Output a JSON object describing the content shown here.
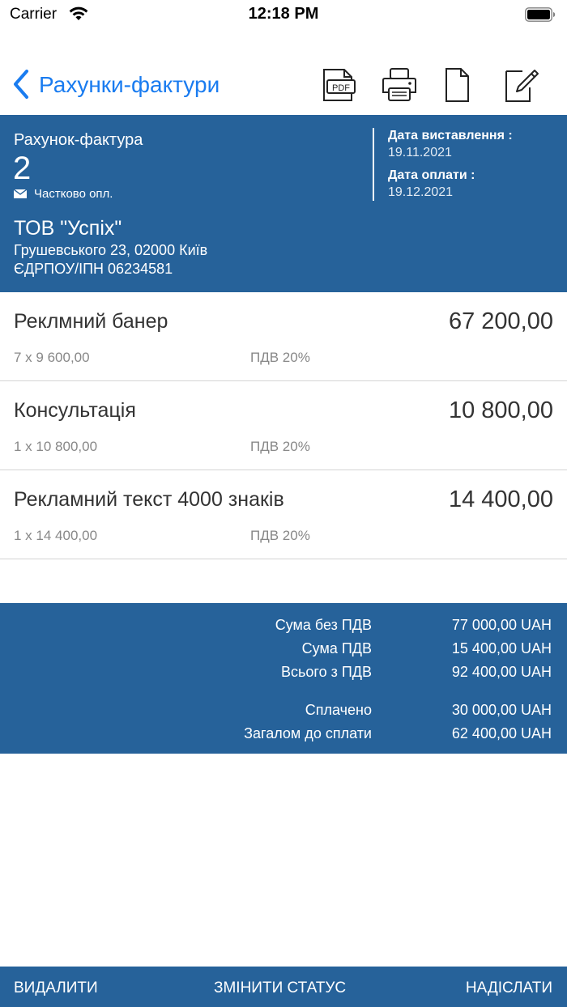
{
  "status_bar": {
    "carrier": "Carrier",
    "time": "12:18 PM"
  },
  "nav": {
    "back_label": "Рахунки-фактури",
    "accent_color": "#1a7cf0",
    "tools": [
      "pdf-icon",
      "printer-icon",
      "document-icon",
      "edit-icon"
    ],
    "pdf_icon_text": "PDF"
  },
  "invoice": {
    "kind": "Рахунок-фактура",
    "number": "2",
    "status": "Частково опл.",
    "issue_date_label": "Дата виставлення :",
    "issue_date": "19.11.2021",
    "due_date_label": "Дата оплати :",
    "due_date": "19.12.2021",
    "client_name": "ТОВ \"Успіх\"",
    "client_address": "Грушевського 23, 02000 Київ",
    "client_taxid": "ЄДРПОУ/ІПН 06234581",
    "panel_color": "#26629a"
  },
  "items": [
    {
      "name": "Реклмний банер",
      "total": "67 200,00",
      "qty_price": "7 x 9 600,00",
      "vat": "ПДВ 20%"
    },
    {
      "name": "Консультація",
      "total": "10 800,00",
      "qty_price": "1 x 10 800,00",
      "vat": "ПДВ 20%"
    },
    {
      "name": "Рекламний текст 4000 знаків",
      "total": "14 400,00",
      "qty_price": "1 x 14 400,00",
      "vat": "ПДВ 20%"
    }
  ],
  "totals": {
    "subtotal_label": "Сума без ПДВ",
    "subtotal": "77 000,00 UAH",
    "vat_label": "Сума ПДВ",
    "vat": "15 400,00 UAH",
    "total_label": "Всього з ПДВ",
    "total": "92 400,00 UAH",
    "paid_label": "Сплачено",
    "paid": "30 000,00 UAH",
    "due_label": "Загалом до сплати",
    "due": "62 400,00 UAH"
  },
  "bottom_bar": {
    "delete": "ВИДАЛИТИ",
    "change_status": "ЗМІНИТИ СТАТУС",
    "send": "НАДІСЛАТИ"
  }
}
